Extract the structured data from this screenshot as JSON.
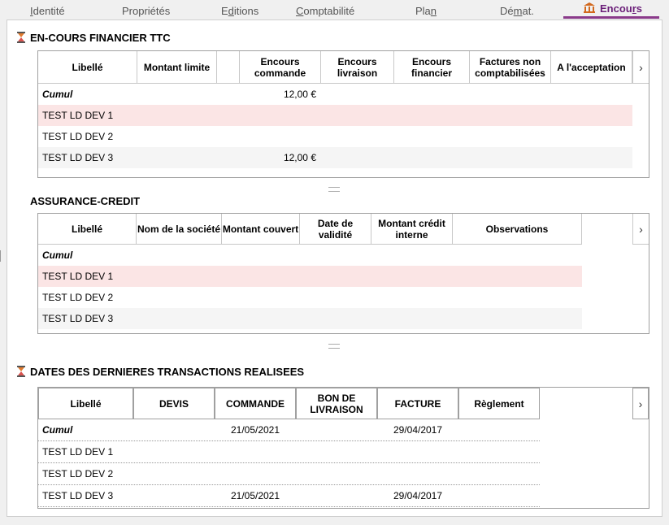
{
  "tabs": [
    {
      "pre": "",
      "u": "I",
      "post": "dentité"
    },
    {
      "pre": "Propriétés",
      "u": "",
      "post": ""
    },
    {
      "pre": "E",
      "u": "d",
      "post": "itions"
    },
    {
      "pre": "",
      "u": "C",
      "post": "omptabilité"
    },
    {
      "pre": "Pla",
      "u": "n",
      "post": ""
    },
    {
      "pre": "Dé",
      "u": "m",
      "post": "at."
    },
    {
      "pre": "Encou",
      "u": "r",
      "post": "s"
    }
  ],
  "section1": {
    "title": "EN-COURS FINANCIER TTC",
    "headers": [
      "Libellé",
      "Montant limite",
      "",
      "Encours commande",
      "Encours livraison",
      "Encours financier",
      "Factures non comptabilisées",
      "A  l'acceptation"
    ],
    "rows": [
      {
        "label": "Cumul",
        "encours_commande": "12,00 €"
      },
      {
        "label": "TEST LD DEV 1",
        "encours_commande": ""
      },
      {
        "label": "TEST LD DEV 2",
        "encours_commande": ""
      },
      {
        "label": "TEST LD DEV 3",
        "encours_commande": "12,00 €"
      }
    ]
  },
  "section2": {
    "title": "ASSURANCE-CREDIT",
    "headers": [
      "Libellé",
      "Nom de la société",
      "Montant couvert",
      "Date de validité",
      "Montant crédit interne",
      "Observations"
    ],
    "rows": [
      {
        "label": "Cumul"
      },
      {
        "label": "TEST LD DEV 1"
      },
      {
        "label": "TEST LD DEV 2"
      },
      {
        "label": "TEST LD DEV 3"
      }
    ]
  },
  "section3": {
    "title": "DATES DES DERNIERES TRANSACTIONS REALISEES",
    "headers": [
      "Libellé",
      "DEVIS",
      "COMMANDE",
      "BON DE LIVRAISON",
      "FACTURE",
      "Règlement"
    ],
    "rows": [
      {
        "label": "Cumul",
        "commande": "21/05/2021",
        "facture": "29/04/2017"
      },
      {
        "label": "TEST LD DEV 1",
        "commande": "",
        "facture": ""
      },
      {
        "label": "TEST LD DEV 2",
        "commande": "",
        "facture": ""
      },
      {
        "label": "TEST LD DEV 3",
        "commande": "21/05/2021",
        "facture": "29/04/2017"
      }
    ]
  },
  "icons": {
    "scroll_next": "›",
    "tab_encours": "bank-icon",
    "section": "hourglass-icon"
  },
  "colors": {
    "accent": "#8a3a8a",
    "row_highlight": "#fbe5e5",
    "row_alt": "#f5f5f5"
  }
}
